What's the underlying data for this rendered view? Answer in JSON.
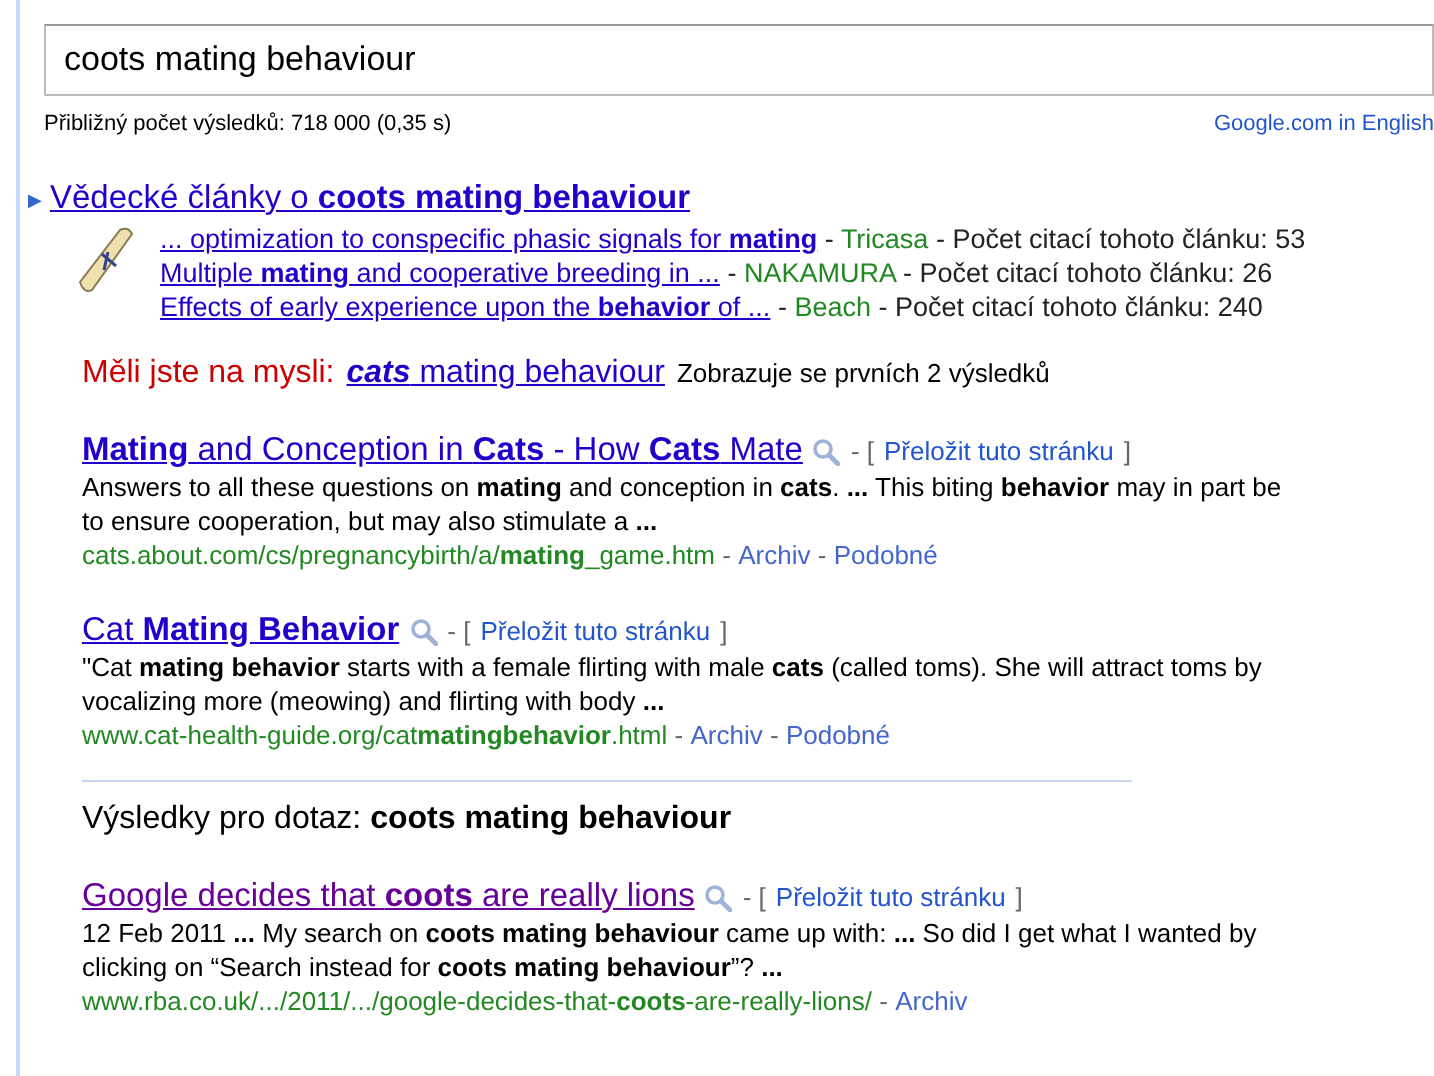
{
  "search": {
    "value": "coots mating behaviour"
  },
  "stats": "Přibližný počet výsledků: 718 000 (0,35 s)",
  "english_link": "Google.com in English",
  "scholar": {
    "marker": "▶",
    "title": "Vědecké články o **coots mating behaviour**",
    "items": [
      {
        "title": "... optimization to conspecific phasic signals for **mating**",
        "dash_1": "-",
        "author": "Tricasa",
        "dash_2": "-",
        "citations": "Počet citací tohoto článku: 53"
      },
      {
        "title": "Multiple **mating** and cooperative breeding in ...",
        "dash_1": "-",
        "author": "NAKAMURA",
        "dash_2": "-",
        "citations": "Počet citací tohoto článku: 26"
      },
      {
        "title": "Effects of early experience upon the **behavior** of ...",
        "dash_1": "-",
        "author": "Beach",
        "dash_2": "-",
        "citations": "Počet citací tohoto článku: 240"
      }
    ]
  },
  "did_you_mean": {
    "label": "Měli jste na mysli:",
    "suggestion": "**cats** mating behaviour",
    "note": "Zobrazuje se prvních 2 výsledků"
  },
  "results_before": [
    {
      "title": "**Mating** and Conception in **Cats** - How **Cats** Mate",
      "visited": false,
      "translate_open": "- [",
      "translate": "Přeložit tuto stránku",
      "translate_close": "]",
      "snippet": "Answers to all these questions on **mating** and conception in **cats**. **...** This biting **behavior** may in part be to ensure cooperation, but may also stimulate a **...**",
      "url": "cats.about.com/cs/pregnancybirth/a/**mating**_game.htm",
      "links": [
        {
          "dash": "-",
          "label": "Archiv"
        },
        {
          "dash": "-",
          "label": "Podobné"
        }
      ]
    },
    {
      "title": "Cat **Mating Behavior**",
      "visited": false,
      "translate_open": "- [",
      "translate": "Přeložit tuto stránku",
      "translate_close": "]",
      "snippet": "\"Cat **mating behavior** starts with a female flirting with male **cats** (called toms). She will attract toms by vocalizing more (meowing) and flirting with body **...**",
      "url": "www.cat-health-guide.org/cat**matingbehavior**.html",
      "links": [
        {
          "dash": "-",
          "label": "Archiv"
        },
        {
          "dash": "-",
          "label": "Podobné"
        }
      ]
    }
  ],
  "results_for": {
    "label": "Výsledky pro dotaz:",
    "query": "coots mating behaviour"
  },
  "results_after": [
    {
      "title": "Google decides that **coots** are really lions",
      "visited": true,
      "translate_open": "- [",
      "translate": "Přeložit tuto stránku",
      "translate_close": "]",
      "snippet": "12 Feb 2011 **...** My search on **coots mating behaviour** came up with: **...** So did I get what I wanted by clicking on “Search instead for **coots mating behaviour**”? **...**",
      "url": "www.rba.co.uk/.../2011/.../google-decides-that-**coots**-are-really-lions/",
      "links": [
        {
          "dash": "-",
          "label": "Archiv"
        }
      ]
    }
  ]
}
